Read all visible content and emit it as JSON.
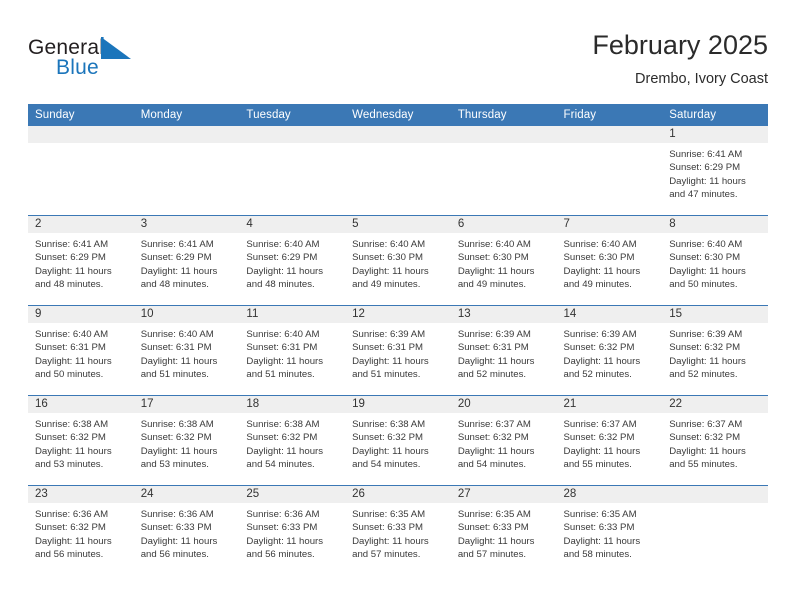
{
  "brand": {
    "word_top": "General",
    "word_bottom": "Blue",
    "flag_icon": "blue-flag-triangle-icon",
    "color_dark": "#231f20",
    "color_blue": "#1b75bb"
  },
  "header": {
    "title": "February 2025",
    "subtitle": "Drembo, Ivory Coast"
  },
  "theme": {
    "header_blue": "#3b78b5",
    "daynum_gray": "#efefef",
    "text": "#3a3a3a"
  },
  "weekday_headers": [
    "Sunday",
    "Monday",
    "Tuesday",
    "Wednesday",
    "Thursday",
    "Friday",
    "Saturday"
  ],
  "labels": {
    "sunrise_prefix": "Sunrise:",
    "sunset_prefix": "Sunset:",
    "daylight_prefix": "Daylight:"
  },
  "weeks": [
    [
      {
        "day": "",
        "empty": true
      },
      {
        "day": "",
        "empty": true
      },
      {
        "day": "",
        "empty": true
      },
      {
        "day": "",
        "empty": true
      },
      {
        "day": "",
        "empty": true
      },
      {
        "day": "",
        "empty": true
      },
      {
        "day": "1",
        "sunrise": "Sunrise: 6:41 AM",
        "sunset": "Sunset: 6:29 PM",
        "daylight_1": "Daylight: 11 hours",
        "daylight_2": "and 47 minutes."
      }
    ],
    [
      {
        "day": "2",
        "sunrise": "Sunrise: 6:41 AM",
        "sunset": "Sunset: 6:29 PM",
        "daylight_1": "Daylight: 11 hours",
        "daylight_2": "and 48 minutes."
      },
      {
        "day": "3",
        "sunrise": "Sunrise: 6:41 AM",
        "sunset": "Sunset: 6:29 PM",
        "daylight_1": "Daylight: 11 hours",
        "daylight_2": "and 48 minutes."
      },
      {
        "day": "4",
        "sunrise": "Sunrise: 6:40 AM",
        "sunset": "Sunset: 6:29 PM",
        "daylight_1": "Daylight: 11 hours",
        "daylight_2": "and 48 minutes."
      },
      {
        "day": "5",
        "sunrise": "Sunrise: 6:40 AM",
        "sunset": "Sunset: 6:30 PM",
        "daylight_1": "Daylight: 11 hours",
        "daylight_2": "and 49 minutes."
      },
      {
        "day": "6",
        "sunrise": "Sunrise: 6:40 AM",
        "sunset": "Sunset: 6:30 PM",
        "daylight_1": "Daylight: 11 hours",
        "daylight_2": "and 49 minutes."
      },
      {
        "day": "7",
        "sunrise": "Sunrise: 6:40 AM",
        "sunset": "Sunset: 6:30 PM",
        "daylight_1": "Daylight: 11 hours",
        "daylight_2": "and 49 minutes."
      },
      {
        "day": "8",
        "sunrise": "Sunrise: 6:40 AM",
        "sunset": "Sunset: 6:30 PM",
        "daylight_1": "Daylight: 11 hours",
        "daylight_2": "and 50 minutes."
      }
    ],
    [
      {
        "day": "9",
        "sunrise": "Sunrise: 6:40 AM",
        "sunset": "Sunset: 6:31 PM",
        "daylight_1": "Daylight: 11 hours",
        "daylight_2": "and 50 minutes."
      },
      {
        "day": "10",
        "sunrise": "Sunrise: 6:40 AM",
        "sunset": "Sunset: 6:31 PM",
        "daylight_1": "Daylight: 11 hours",
        "daylight_2": "and 51 minutes."
      },
      {
        "day": "11",
        "sunrise": "Sunrise: 6:40 AM",
        "sunset": "Sunset: 6:31 PM",
        "daylight_1": "Daylight: 11 hours",
        "daylight_2": "and 51 minutes."
      },
      {
        "day": "12",
        "sunrise": "Sunrise: 6:39 AM",
        "sunset": "Sunset: 6:31 PM",
        "daylight_1": "Daylight: 11 hours",
        "daylight_2": "and 51 minutes."
      },
      {
        "day": "13",
        "sunrise": "Sunrise: 6:39 AM",
        "sunset": "Sunset: 6:31 PM",
        "daylight_1": "Daylight: 11 hours",
        "daylight_2": "and 52 minutes."
      },
      {
        "day": "14",
        "sunrise": "Sunrise: 6:39 AM",
        "sunset": "Sunset: 6:32 PM",
        "daylight_1": "Daylight: 11 hours",
        "daylight_2": "and 52 minutes."
      },
      {
        "day": "15",
        "sunrise": "Sunrise: 6:39 AM",
        "sunset": "Sunset: 6:32 PM",
        "daylight_1": "Daylight: 11 hours",
        "daylight_2": "and 52 minutes."
      }
    ],
    [
      {
        "day": "16",
        "sunrise": "Sunrise: 6:38 AM",
        "sunset": "Sunset: 6:32 PM",
        "daylight_1": "Daylight: 11 hours",
        "daylight_2": "and 53 minutes."
      },
      {
        "day": "17",
        "sunrise": "Sunrise: 6:38 AM",
        "sunset": "Sunset: 6:32 PM",
        "daylight_1": "Daylight: 11 hours",
        "daylight_2": "and 53 minutes."
      },
      {
        "day": "18",
        "sunrise": "Sunrise: 6:38 AM",
        "sunset": "Sunset: 6:32 PM",
        "daylight_1": "Daylight: 11 hours",
        "daylight_2": "and 54 minutes."
      },
      {
        "day": "19",
        "sunrise": "Sunrise: 6:38 AM",
        "sunset": "Sunset: 6:32 PM",
        "daylight_1": "Daylight: 11 hours",
        "daylight_2": "and 54 minutes."
      },
      {
        "day": "20",
        "sunrise": "Sunrise: 6:37 AM",
        "sunset": "Sunset: 6:32 PM",
        "daylight_1": "Daylight: 11 hours",
        "daylight_2": "and 54 minutes."
      },
      {
        "day": "21",
        "sunrise": "Sunrise: 6:37 AM",
        "sunset": "Sunset: 6:32 PM",
        "daylight_1": "Daylight: 11 hours",
        "daylight_2": "and 55 minutes."
      },
      {
        "day": "22",
        "sunrise": "Sunrise: 6:37 AM",
        "sunset": "Sunset: 6:32 PM",
        "daylight_1": "Daylight: 11 hours",
        "daylight_2": "and 55 minutes."
      }
    ],
    [
      {
        "day": "23",
        "sunrise": "Sunrise: 6:36 AM",
        "sunset": "Sunset: 6:32 PM",
        "daylight_1": "Daylight: 11 hours",
        "daylight_2": "and 56 minutes."
      },
      {
        "day": "24",
        "sunrise": "Sunrise: 6:36 AM",
        "sunset": "Sunset: 6:33 PM",
        "daylight_1": "Daylight: 11 hours",
        "daylight_2": "and 56 minutes."
      },
      {
        "day": "25",
        "sunrise": "Sunrise: 6:36 AM",
        "sunset": "Sunset: 6:33 PM",
        "daylight_1": "Daylight: 11 hours",
        "daylight_2": "and 56 minutes."
      },
      {
        "day": "26",
        "sunrise": "Sunrise: 6:35 AM",
        "sunset": "Sunset: 6:33 PM",
        "daylight_1": "Daylight: 11 hours",
        "daylight_2": "and 57 minutes."
      },
      {
        "day": "27",
        "sunrise": "Sunrise: 6:35 AM",
        "sunset": "Sunset: 6:33 PM",
        "daylight_1": "Daylight: 11 hours",
        "daylight_2": "and 57 minutes."
      },
      {
        "day": "28",
        "sunrise": "Sunrise: 6:35 AM",
        "sunset": "Sunset: 6:33 PM",
        "daylight_1": "Daylight: 11 hours",
        "daylight_2": "and 58 minutes."
      },
      {
        "day": "",
        "empty": true
      }
    ]
  ]
}
